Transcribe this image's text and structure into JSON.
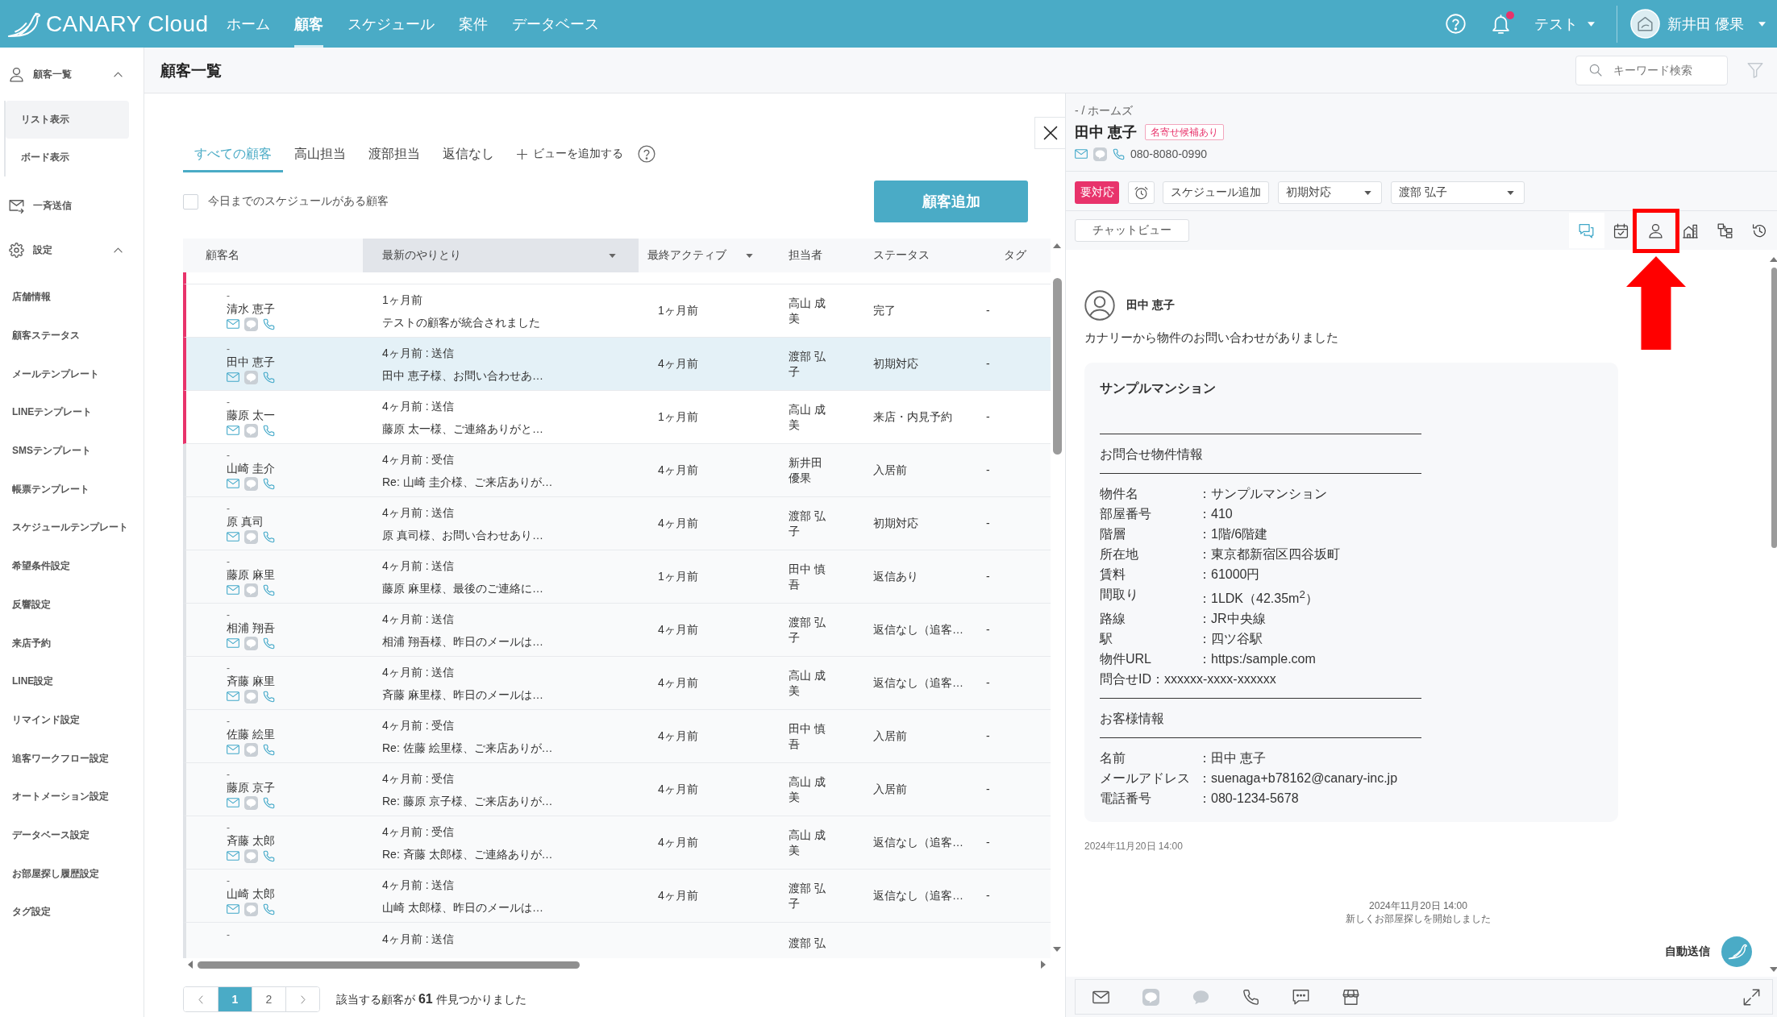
{
  "topbar": {
    "logo_text": "CANARY Cloud",
    "nav": [
      {
        "label": "ホーム",
        "selected": false
      },
      {
        "label": "顧客",
        "selected": true
      },
      {
        "label": "スケジュール",
        "selected": false
      },
      {
        "label": "案件",
        "selected": false
      },
      {
        "label": "データベース",
        "selected": false
      }
    ],
    "has_notification": true,
    "workspace": "テスト",
    "user_name": "新井田 優果"
  },
  "sidebar": [
    {
      "kind": "customers",
      "label": "顧客一覧",
      "expanded": true,
      "items": [
        {
          "label": "リスト表示",
          "selected": true
        },
        {
          "label": "ボード表示",
          "selected": false
        }
      ]
    },
    {
      "kind": "broadcast",
      "label": "一斉送信"
    },
    {
      "kind": "settings",
      "label": "設定",
      "expanded": true,
      "items": [
        {
          "label": "店舗情報",
          "selected": false
        },
        {
          "label": "顧客ステータス",
          "selected": false
        },
        {
          "label": "メールテンプレート",
          "selected": false
        },
        {
          "label": "LINEテンプレート",
          "selected": false
        },
        {
          "label": "SMSテンプレート",
          "selected": false
        },
        {
          "label": "帳票テンプレート",
          "selected": false
        },
        {
          "label": "スケジュールテンプレート",
          "selected": false
        },
        {
          "label": "希望条件設定",
          "selected": false
        },
        {
          "label": "反響設定",
          "selected": false
        },
        {
          "label": "来店予約",
          "selected": false
        },
        {
          "label": "LINE設定",
          "selected": false
        },
        {
          "label": "リマインド設定",
          "selected": false
        },
        {
          "label": "追客ワークフロー設定",
          "selected": false
        },
        {
          "label": "オートメーション設定",
          "selected": false
        },
        {
          "label": "データベース設定",
          "selected": false
        },
        {
          "label": "お部屋探し履歴設定",
          "selected": false
        },
        {
          "label": "タグ設定",
          "selected": false
        }
      ]
    }
  ],
  "page": {
    "title": "顧客一覧",
    "search": {
      "placeholder": "キーワード検索"
    }
  },
  "customer_list": {
    "tabs": [
      {
        "label": "すべての顧客",
        "selected": true
      },
      {
        "label": "高山担当",
        "selected": false
      },
      {
        "label": "渡部担当",
        "selected": false
      },
      {
        "label": "返信なし",
        "selected": false
      }
    ],
    "add_view_label": "ビューを追加する",
    "schedule_filter": {
      "label": "今日までのスケジュールがある顧客",
      "checked": false
    },
    "add_button": "顧客追加",
    "table": {
      "columns": [
        {
          "label": "顧客名",
          "sortable": false,
          "sorted": false
        },
        {
          "label": "最新のやりとり",
          "sortable": true,
          "sorted": true
        },
        {
          "label": "最終アクティブ",
          "sortable": true,
          "sorted": false
        },
        {
          "label": "担当者",
          "sortable": false,
          "sorted": false
        },
        {
          "label": "ステータス",
          "sortable": false,
          "sorted": false
        },
        {
          "label": "タグ",
          "sortable": false,
          "sorted": false
        }
      ],
      "top_partial_row": {
        "flagged": true
      },
      "rows": [
        {
          "flagged": true,
          "selected": false,
          "subtitle": "-",
          "name": "清水 恵子",
          "line_linked": false,
          "latest_time": "1ヶ月前",
          "latest_text": "テストの顧客が統合されました",
          "last_active": "1ヶ月前",
          "assignee": "高山 成美",
          "status": "完了",
          "tag": "-"
        },
        {
          "flagged": true,
          "selected": true,
          "subtitle": "-",
          "name": "田中 恵子",
          "line_linked": false,
          "latest_time": "4ヶ月前 : 送信",
          "latest_text": "田中 恵子様、お問い合わせあ…",
          "last_active": "4ヶ月前",
          "assignee": "渡部 弘子",
          "status": "初期対応",
          "tag": "-"
        },
        {
          "flagged": true,
          "selected": false,
          "subtitle": "-",
          "name": "藤原 太一",
          "line_linked": false,
          "latest_time": "4ヶ月前 : 送信",
          "latest_text": "藤原 太一様、ご連絡ありがと…",
          "last_active": "1ヶ月前",
          "assignee": "高山 成美",
          "status": "来店・内見予約",
          "tag": "-"
        },
        {
          "flagged": false,
          "selected": false,
          "subtitle": "-",
          "name": "山崎 圭介",
          "line_linked": false,
          "latest_time": "4ヶ月前 : 受信",
          "latest_text": "Re: 山崎 圭介様、ご来店ありが…",
          "last_active": "4ヶ月前",
          "assignee": "新井田優果",
          "status": "入居前",
          "tag": "-"
        },
        {
          "flagged": false,
          "selected": false,
          "subtitle": "-",
          "name": "原 真司",
          "line_linked": false,
          "latest_time": "4ヶ月前 : 送信",
          "latest_text": "原 真司様、お問い合わせあり…",
          "last_active": "4ヶ月前",
          "assignee": "渡部 弘子",
          "status": "初期対応",
          "tag": "-"
        },
        {
          "flagged": false,
          "selected": false,
          "subtitle": "-",
          "name": "藤原 麻里",
          "line_linked": false,
          "latest_time": "4ヶ月前 : 送信",
          "latest_text": "藤原 麻里様、最後のご連絡に…",
          "last_active": "1ヶ月前",
          "assignee": "田中 慎吾",
          "status": "返信あり",
          "tag": "-"
        },
        {
          "flagged": false,
          "selected": false,
          "subtitle": "-",
          "name": "相浦 翔吾",
          "line_linked": false,
          "latest_time": "4ヶ月前 : 送信",
          "latest_text": "相浦 翔吾様、昨日のメールは…",
          "last_active": "4ヶ月前",
          "assignee": "渡部 弘子",
          "status": "返信なし（追客…",
          "tag": "-"
        },
        {
          "flagged": false,
          "selected": false,
          "subtitle": "-",
          "name": "斉藤 麻里",
          "line_linked": false,
          "latest_time": "4ヶ月前 : 送信",
          "latest_text": "斉藤 麻里様、昨日のメールは…",
          "last_active": "4ヶ月前",
          "assignee": "高山 成美",
          "status": "返信なし（追客…",
          "tag": "-"
        },
        {
          "flagged": false,
          "selected": false,
          "subtitle": "-",
          "name": "佐藤 絵里",
          "line_linked": false,
          "latest_time": "4ヶ月前 : 受信",
          "latest_text": "Re: 佐藤 絵里様、ご来店ありが…",
          "last_active": "4ヶ月前",
          "assignee": "田中 慎吾",
          "status": "入居前",
          "tag": "-"
        },
        {
          "flagged": false,
          "selected": false,
          "subtitle": "-",
          "name": "藤原 京子",
          "line_linked": false,
          "latest_time": "4ヶ月前 : 受信",
          "latest_text": "Re: 藤原 京子様、ご来店ありが…",
          "last_active": "4ヶ月前",
          "assignee": "高山 成美",
          "status": "入居前",
          "tag": "-"
        },
        {
          "flagged": false,
          "selected": false,
          "subtitle": "-",
          "name": "斉藤 太郎",
          "line_linked": false,
          "latest_time": "4ヶ月前 : 受信",
          "latest_text": "Re: 斉藤 太郎様、ご連絡ありが…",
          "last_active": "4ヶ月前",
          "assignee": "高山 成美",
          "status": "返信なし（追客…",
          "tag": "-"
        },
        {
          "flagged": false,
          "selected": false,
          "subtitle": "-",
          "name": "山崎 太郎",
          "line_linked": false,
          "latest_time": "4ヶ月前 : 送信",
          "latest_text": "山崎 太郎様、昨日のメールは…",
          "last_active": "4ヶ月前",
          "assignee": "渡部 弘子",
          "status": "返信なし（追客…",
          "tag": "-"
        }
      ],
      "partial_row": {
        "flagged": false,
        "subtitle": "-",
        "latest_time": "4ヶ月前 : 送信",
        "assignee": "渡部 弘"
      }
    },
    "pagination": {
      "pages": [
        {
          "label": "1",
          "selected": true
        },
        {
          "label": "2",
          "selected": false
        }
      ],
      "summary": "該当する顧客が **61** 件見つかりました"
    }
  },
  "detail": {
    "breadcrumb": "- / ホームズ",
    "name": "田中 恵子",
    "badge": "名寄せ候補あり",
    "line_linked": false,
    "phone": "080-8080-0990",
    "priority": "要対応",
    "schedule_button": "スケジュール追加",
    "status": "初期対応",
    "assignee": "渡部 弘子",
    "view_button": "チャットビュー",
    "views": [
      {
        "kind": "chat",
        "selected": true,
        "annotated": false
      },
      {
        "kind": "schedule",
        "selected": false,
        "annotated": false
      },
      {
        "kind": "profile",
        "selected": false,
        "annotated": true
      },
      {
        "kind": "property",
        "selected": false,
        "annotated": false
      },
      {
        "kind": "workflow",
        "selected": false,
        "annotated": false
      },
      {
        "kind": "history",
        "selected": false,
        "annotated": false
      }
    ],
    "chat": {
      "sender": "田中 恵子",
      "intro": "カナリーから物件のお問い合わせがありました",
      "card_lines": [
        {
          "kind": "title",
          "text": "サンプルマンション"
        },
        {
          "kind": "rule"
        },
        {
          "kind": "text",
          "text": "お問合せ物件情報"
        },
        {
          "kind": "rule"
        },
        {
          "kind": "field",
          "label": "物件名",
          "value": "：サンプルマンション"
        },
        {
          "kind": "field",
          "label": "部屋番号",
          "value": "：410"
        },
        {
          "kind": "field",
          "label": "階層",
          "value": "：1階/6階建"
        },
        {
          "kind": "field",
          "label": "所在地",
          "value": "：東京都新宿区四谷坂町"
        },
        {
          "kind": "field",
          "label": "賃料",
          "value": "：61000円"
        },
        {
          "kind": "field",
          "label": "間取り",
          "value": "：1LDK（42.35m$^{2}$）"
        },
        {
          "kind": "field",
          "label": "路線",
          "value": "：JR中央線"
        },
        {
          "kind": "field",
          "label": "駅",
          "value": "：四ツ谷駅"
        },
        {
          "kind": "field",
          "label": "物件URL",
          "value": "：https:/sample.com"
        },
        {
          "kind": "text",
          "text": "問合せID：xxxxxx-xxxx-xxxxxx"
        },
        {
          "kind": "rule"
        },
        {
          "kind": "text",
          "text": "お客様情報"
        },
        {
          "kind": "rule"
        },
        {
          "kind": "field",
          "label": "名前",
          "value": "：田中 恵子"
        },
        {
          "kind": "field",
          "label": "メールアドレス",
          "value": "：suenaga+b78162@canary-inc.jp"
        },
        {
          "kind": "field",
          "label": "電話番号",
          "value": "：080-1234-5678"
        }
      ],
      "sent_at": "2024年11月20日 14:00",
      "event": {
        "time": "2024年11月20日 14:00",
        "text": "新しくお部屋探しを開始しました"
      },
      "auto_label": "自動送信"
    },
    "composer": [
      {
        "kind": "mail",
        "enabled": true
      },
      {
        "kind": "line",
        "enabled": false
      },
      {
        "kind": "sms",
        "enabled": false
      },
      {
        "kind": "phone",
        "enabled": true
      },
      {
        "kind": "memo",
        "enabled": true
      },
      {
        "kind": "store",
        "enabled": true
      }
    ]
  }
}
